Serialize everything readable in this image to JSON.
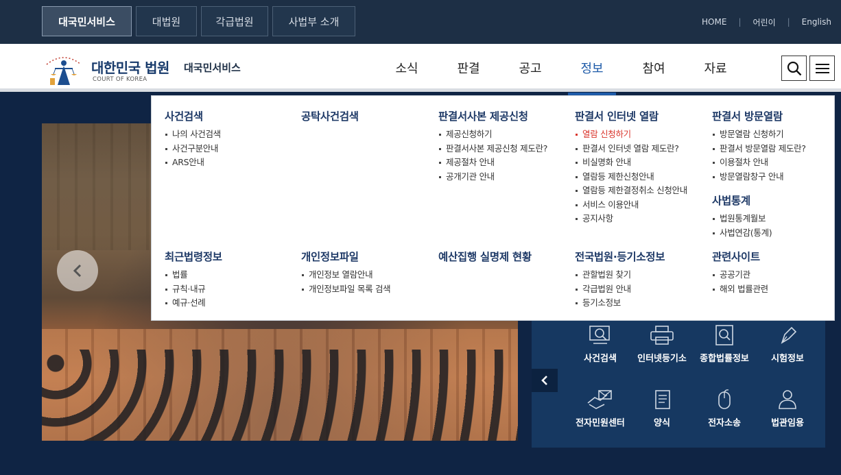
{
  "top_tabs": [
    "대국민서비스",
    "대법원",
    "각급법원",
    "사법부 소개"
  ],
  "top_links": [
    "HOME",
    "어린이",
    "English"
  ],
  "brand": {
    "title": "대한민국 법원",
    "english": "COURT OF KOREA",
    "subtitle": "대국민서비스"
  },
  "gnb": [
    "소식",
    "판결",
    "공고",
    "정보",
    "참여",
    "자료"
  ],
  "gnb_active": "정보",
  "mega_menu": [
    {
      "title": "사건검색",
      "items": [
        "나의 사건검색",
        "사건구분안내",
        "ARS안내"
      ]
    },
    {
      "title": "공탁사건검색",
      "items": []
    },
    {
      "title": "판결서사본 제공신청",
      "items": [
        "제공신청하기",
        "판결서사본 제공신청 제도란?",
        "제공절차 안내",
        "공개기관 안내"
      ]
    },
    {
      "title": "판결서 인터넷 열람",
      "items": [
        "열람 신청하기",
        "판결서 인터넷 열람 제도란?",
        "비실명화 안내",
        "열람등 제한신청안내",
        "열람등 제한결정취소 신청안내",
        "서비스 이용안내",
        "공지사항"
      ]
    },
    {
      "title": "판결서 방문열람",
      "items": [
        "방문열람 신청하기",
        "판결서 방문열람 제도란?",
        "이용절차 안내",
        "방문열람창구 안내"
      ]
    },
    {
      "title": "사법통계",
      "items": [
        "법원통계월보",
        "사법연감(통계)"
      ]
    },
    {
      "title": "최근법령정보",
      "items": [
        "법률",
        "규칙·내규",
        "예규·선례"
      ]
    },
    {
      "title": "개인정보파일",
      "items": [
        "개인정보 열람안내",
        "개인정보파일 목록 검색"
      ]
    },
    {
      "title": "예산집행 실명제 현황",
      "items": []
    },
    {
      "title": "전국법원·등기소정보",
      "items": [
        "관할법원 찾기",
        "각급법원 안내",
        "등기소정보"
      ]
    },
    {
      "title": "관련사이트",
      "items": [
        "공공기관",
        "해외 법률관련"
      ]
    }
  ],
  "highlighted_item": "열람 신청하기",
  "quick_menu": [
    "사건검색",
    "인터넷등기소",
    "종합법률정보",
    "시험정보",
    "전자민원센터",
    "양식",
    "전자소송",
    "법관임용"
  ],
  "icons": {
    "search": "search-icon",
    "menu": "hamburger-menu-icon",
    "prev": "chevron-left-icon"
  },
  "colors": {
    "topbar": "#1d2f45",
    "accent": "#1d5aa8",
    "menu_title": "#1f3a67",
    "highlight": "#d9342b",
    "quick_bg": "#163861"
  }
}
